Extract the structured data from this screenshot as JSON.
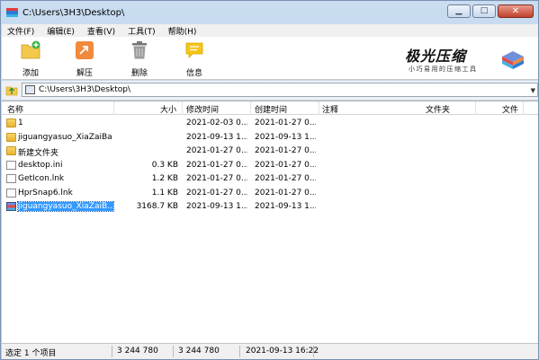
{
  "window": {
    "title": "C:\\Users\\3H3\\Desktop\\",
    "buttons": {
      "minimize": "▁",
      "maximize": "□",
      "close": "✕"
    }
  },
  "menu": [
    "文件(F)",
    "编辑(E)",
    "查看(V)",
    "工具(T)",
    "帮助(H)"
  ],
  "toolbar": {
    "tools": [
      {
        "label": "添加",
        "icon": "add-folder-icon"
      },
      {
        "label": "解压",
        "icon": "extract-icon"
      },
      {
        "label": "删除",
        "icon": "trash-icon"
      },
      {
        "label": "信息",
        "icon": "info-icon"
      }
    ],
    "brand_title": "极光压缩",
    "brand_sub": "小巧易用的压缩工具",
    "brand_icon": "app-logo-icon"
  },
  "address": {
    "path": "C:\\Users\\3H3\\Desktop\\"
  },
  "columns": {
    "name": "名称",
    "size": "大小",
    "modified": "修改时间",
    "created": "创建时间",
    "comment": "注释",
    "filetype": "文件夹",
    "file": "文件"
  },
  "rows": [
    {
      "name": "1",
      "size": "",
      "modified": "2021-02-03 0...",
      "created": "2021-01-27 0...",
      "type": "folder"
    },
    {
      "name": "jiguangyasuo_XiaZaiBa",
      "size": "",
      "modified": "2021-09-13 1...",
      "created": "2021-09-13 1...",
      "type": "folder"
    },
    {
      "name": "新建文件夹",
      "size": "",
      "modified": "2021-01-27 0...",
      "created": "2021-01-27 0...",
      "type": "folder"
    },
    {
      "name": "desktop.ini",
      "size": "0.3 KB",
      "modified": "2021-01-27 0...",
      "created": "2021-01-27 0...",
      "type": "file"
    },
    {
      "name": "GetIcon.lnk",
      "size": "1.2 KB",
      "modified": "2021-01-27 0...",
      "created": "2021-01-27 0...",
      "type": "lnk"
    },
    {
      "name": "HprSnap6.lnk",
      "size": "1.1 KB",
      "modified": "2021-01-27 0...",
      "created": "2021-01-27 0...",
      "type": "lnk"
    },
    {
      "name": "jiguangyasuo_XiaZaiB...",
      "size": "3168.7 KB",
      "modified": "2021-09-13 1...",
      "created": "2021-09-13 1...",
      "type": "zip",
      "selected": true
    }
  ],
  "status": {
    "selection": "选定 1 个项目",
    "size1": "3 244 780",
    "size2": "3 244 780",
    "datetime": "2021-09-13 16:22"
  }
}
